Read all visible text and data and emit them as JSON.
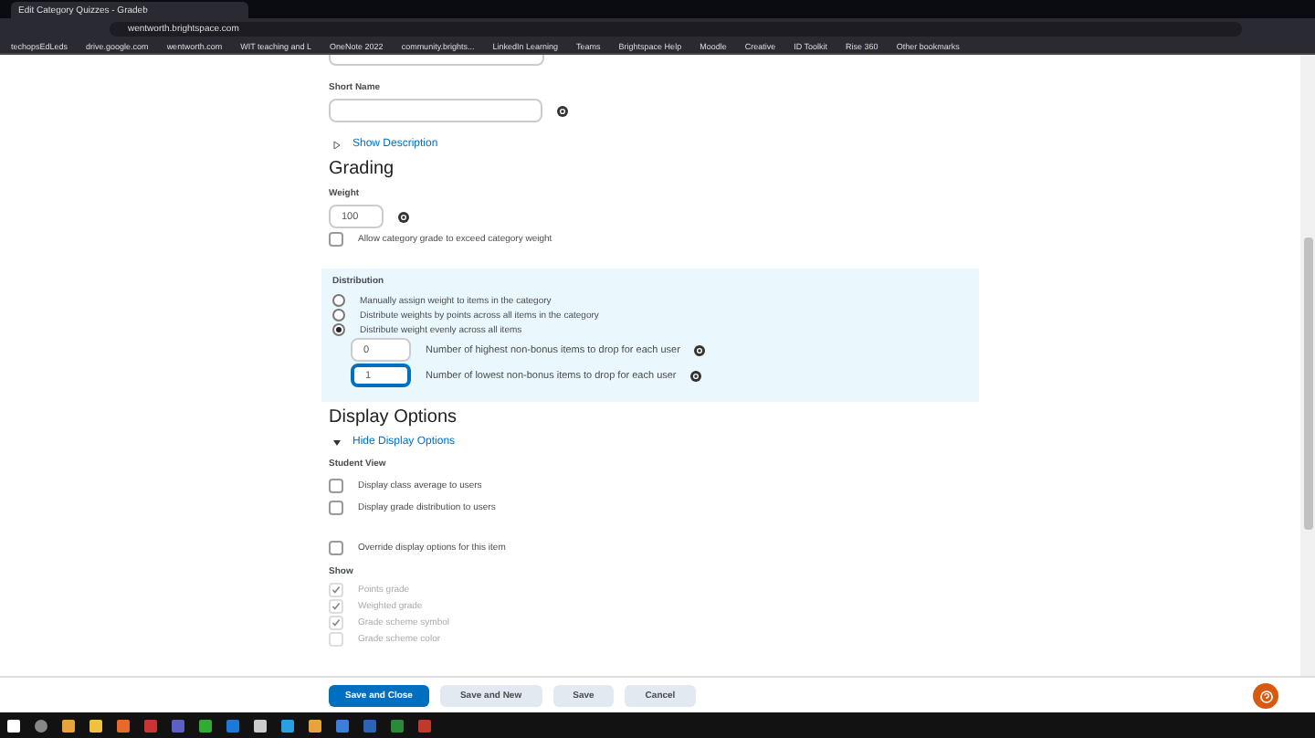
{
  "browser": {
    "tab_title": "Edit Category Quizzes - Gradeb",
    "url": "wentworth.brightspace.com",
    "bookmarks": [
      "techopsEdLeds",
      "drive.google.com",
      "wentworth.com",
      "WIT teaching and L",
      "OneNote 2022",
      "community.brights...",
      "LinkedIn Learning",
      "Teams",
      "Brightspace Help",
      "Moodle",
      "Creative",
      "ID Toolkit",
      "Rise 360",
      "Other bookmarks"
    ]
  },
  "form": {
    "short_name": {
      "label": "Short Name"
    },
    "show_description": "Show Description",
    "grading": {
      "heading": "Grading",
      "weight_label": "Weight",
      "weight": "100",
      "allow_exceed": {
        "label": "Allow category grade to exceed category weight",
        "checked": false
      }
    },
    "distribution": {
      "label": "Distribution",
      "options": [
        {
          "label": "Manually assign weight to items in the category",
          "selected": false
        },
        {
          "label": "Distribute weights by points across all items in the category",
          "selected": false
        },
        {
          "label": "Distribute weight evenly across all items",
          "selected": true
        }
      ],
      "drops": [
        {
          "value": "0",
          "label": "Number of highest non-bonus items to drop for each user",
          "focused": false
        },
        {
          "value": "1",
          "label": "Number of lowest non-bonus items to drop for each user",
          "focused": true
        }
      ]
    },
    "display": {
      "heading": "Display Options",
      "toggle": "Hide Display Options",
      "expanded": true,
      "student_view": "Student View",
      "student_options": [
        {
          "label": "Display class average to users",
          "checked": false
        },
        {
          "label": "Display grade distribution to users",
          "checked": false
        }
      ],
      "override": {
        "label": "Override display options for this item",
        "checked": false
      },
      "show_label": "Show",
      "show_options": [
        {
          "label": "Points grade",
          "checked": true,
          "disabled": true
        },
        {
          "label": "Weighted grade",
          "checked": true,
          "disabled": true
        },
        {
          "label": "Grade scheme symbol",
          "checked": true,
          "disabled": true
        },
        {
          "label": "Grade scheme color",
          "checked": false,
          "disabled": true
        }
      ]
    }
  },
  "buttons": [
    {
      "label": "Save and Close",
      "primary": true
    },
    {
      "label": "Save and New",
      "primary": false
    },
    {
      "label": "Save",
      "primary": false
    },
    {
      "label": "Cancel",
      "primary": false
    }
  ]
}
